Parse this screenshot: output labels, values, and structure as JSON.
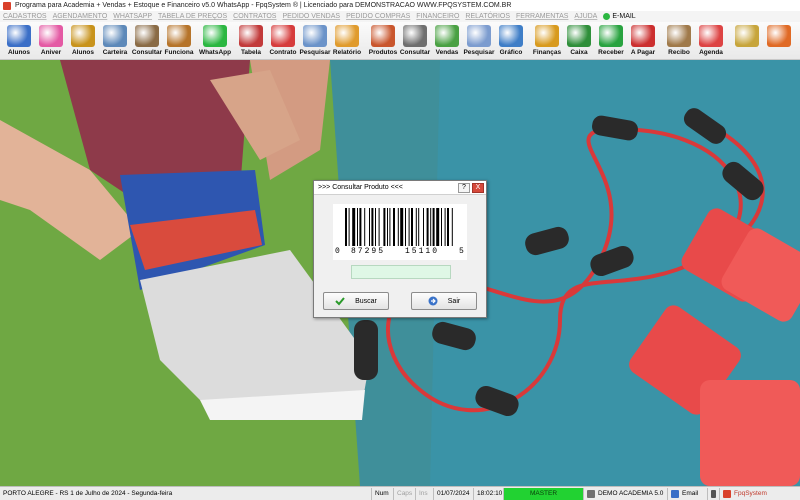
{
  "window": {
    "title": "Programa para Academia + Vendas + Estoque e Financeiro v5.0 WhatsApp - FpqSystem ® | Licenciado para  DEMONSTRACAO WWW.FPQSYSTEM.COM.BR"
  },
  "menu": [
    "CADASTROS",
    "AGENDAMENTO",
    "WHATSAPP",
    "TABELA DE PREÇOS",
    "CONTRATOS",
    "PEDIDO VENDAS",
    "PEDIDO COMPRAS",
    "FINANCEIRO",
    "RELATÓRIOS",
    "FERRAMENTAS",
    "AJUDA"
  ],
  "menu_email": "E-MAIL",
  "toolbar": [
    {
      "label": "Alunos",
      "icon": "students-icon",
      "color": "#3b6fc7"
    },
    {
      "label": "Aniver",
      "icon": "birthday-cake-icon",
      "color": "#e45aa4"
    },
    {
      "label": "Alunos",
      "icon": "students-gold-icon",
      "color": "#c8931c"
    },
    {
      "label": "Carteira",
      "icon": "id-card-icon",
      "color": "#5d89b9"
    },
    {
      "label": "Consultar",
      "icon": "id-search-icon",
      "color": "#8a6b45"
    },
    {
      "label": "Funciona",
      "icon": "employees-icon",
      "color": "#b6742a"
    },
    {
      "label": "WhatsApp",
      "icon": "whatsapp-icon",
      "color": "#2bb741"
    },
    {
      "label": "Tabela",
      "icon": "price-table-icon",
      "color": "#c23a3a"
    },
    {
      "label": "Contrato",
      "icon": "contract-icon",
      "color": "#d63c3c"
    },
    {
      "label": "Pesquisar",
      "icon": "search-document-icon",
      "color": "#6b93c9"
    },
    {
      "label": "Relatório",
      "icon": "report-icon",
      "color": "#e09b2d"
    },
    {
      "label": "Produtos",
      "icon": "products-icon",
      "color": "#c9562d"
    },
    {
      "label": "Consultar",
      "icon": "barcode-reader-icon",
      "color": "#6f6f6f"
    },
    {
      "label": "Vendas",
      "icon": "shopping-cart-icon",
      "color": "#4aa143"
    },
    {
      "label": "Pesquisar",
      "icon": "search-sales-icon",
      "color": "#7c9ccf"
    },
    {
      "label": "Gráfico",
      "icon": "chart-icon",
      "color": "#3f7ec7"
    },
    {
      "label": "Finanças",
      "icon": "finance-icon",
      "color": "#d89a1e"
    },
    {
      "label": "Caixa",
      "icon": "cash-register-icon",
      "color": "#2f8f3a"
    },
    {
      "label": "Receber",
      "icon": "receive-money-icon",
      "color": "#29a340"
    },
    {
      "label": "A Pagar",
      "icon": "pay-money-icon",
      "color": "#cc2f2f"
    },
    {
      "label": "Recibo",
      "icon": "receipt-icon",
      "color": "#a07a4a"
    },
    {
      "label": "Agenda",
      "icon": "calendar-icon",
      "color": "#d44"
    },
    {
      "label": "",
      "icon": "coins-icon",
      "color": "#c7a53b"
    },
    {
      "label": "",
      "icon": "exit-icon",
      "color": "#e06a25"
    }
  ],
  "dialog": {
    "title": ">>> Consultar Produto <<<",
    "help_button": "?",
    "close_button": "X",
    "barcode_digits": {
      "first": "0",
      "left": "87295",
      "right": "15110",
      "last": "5"
    },
    "input_value": "",
    "search_label": "Buscar",
    "exit_label": "Sair"
  },
  "status": {
    "city_date": "PORTO ALEGRE - RS  1 de Julho de 2024 - Segunda-feira",
    "num": "Num",
    "caps": "Caps",
    "ins": "Ins",
    "date": "01/07/2024",
    "time": "18:02:10",
    "master": "MASTER",
    "demo": "DEMO ACADEMIA 5.0",
    "email": "Email",
    "brand": "FpqSystem"
  },
  "colors": {
    "accent_green": "#22d232",
    "input_bg": "#dff7e6",
    "close_red": "#d6493b"
  }
}
